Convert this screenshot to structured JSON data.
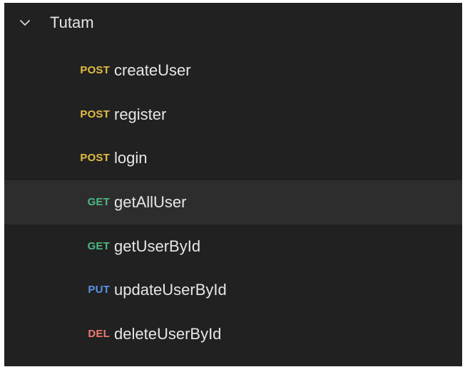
{
  "colors": {
    "panel_bg": "#212121",
    "selected_bg": "#2d2d2d",
    "text": "#e6e6e6",
    "post": "#e3bd45",
    "get": "#4cb883",
    "put": "#5a92e6",
    "del": "#ec7a6f"
  },
  "collection": {
    "name": "Tutam",
    "expanded": true,
    "icon": "chevron-down-icon"
  },
  "requests": [
    {
      "method": "POST",
      "name": "createUser",
      "selected": false
    },
    {
      "method": "POST",
      "name": "register",
      "selected": false
    },
    {
      "method": "POST",
      "name": "login",
      "selected": false
    },
    {
      "method": "GET",
      "name": "getAllUser",
      "selected": true
    },
    {
      "method": "GET",
      "name": "getUserById",
      "selected": false
    },
    {
      "method": "PUT",
      "name": "updateUserById",
      "selected": false
    },
    {
      "method": "DEL",
      "name": "deleteUserById",
      "selected": false
    }
  ]
}
